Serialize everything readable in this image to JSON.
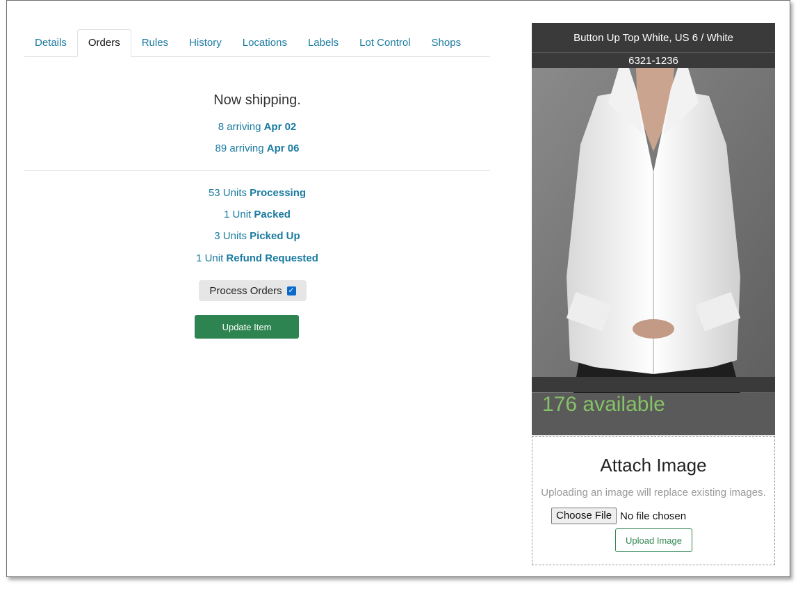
{
  "tabs": [
    {
      "label": "Details"
    },
    {
      "label": "Orders"
    },
    {
      "label": "Rules"
    },
    {
      "label": "History"
    },
    {
      "label": "Locations"
    },
    {
      "label": "Labels"
    },
    {
      "label": "Lot Control"
    },
    {
      "label": "Shops"
    }
  ],
  "active_tab": "Orders",
  "shipping": {
    "title": "Now shipping.",
    "arrivals": [
      {
        "qty": "8 arriving",
        "date": "Apr 02"
      },
      {
        "qty": "89 arriving",
        "date": "Apr 06"
      }
    ]
  },
  "statuses": [
    {
      "count": "53 Units",
      "status": "Processing"
    },
    {
      "count": "1 Unit",
      "status": "Packed"
    },
    {
      "count": "3 Units",
      "status": "Picked Up"
    },
    {
      "count": "1 Unit",
      "status": "Refund Requested"
    }
  ],
  "process_orders": {
    "label": "Process Orders",
    "checked": true
  },
  "update_button": "Update Item",
  "product": {
    "title": "Button Up Top White, US 6 / White",
    "sku": "6321-1236",
    "available": "176 available"
  },
  "attach": {
    "title": "Attach Image",
    "help": "Uploading an image will replace existing images.",
    "choose_label": "Choose File",
    "file_status": "No file chosen",
    "upload_label": "Upload Image"
  },
  "colors": {
    "link": "#1a7aa0",
    "primary_green": "#2e8450",
    "available_green": "#86c266"
  }
}
